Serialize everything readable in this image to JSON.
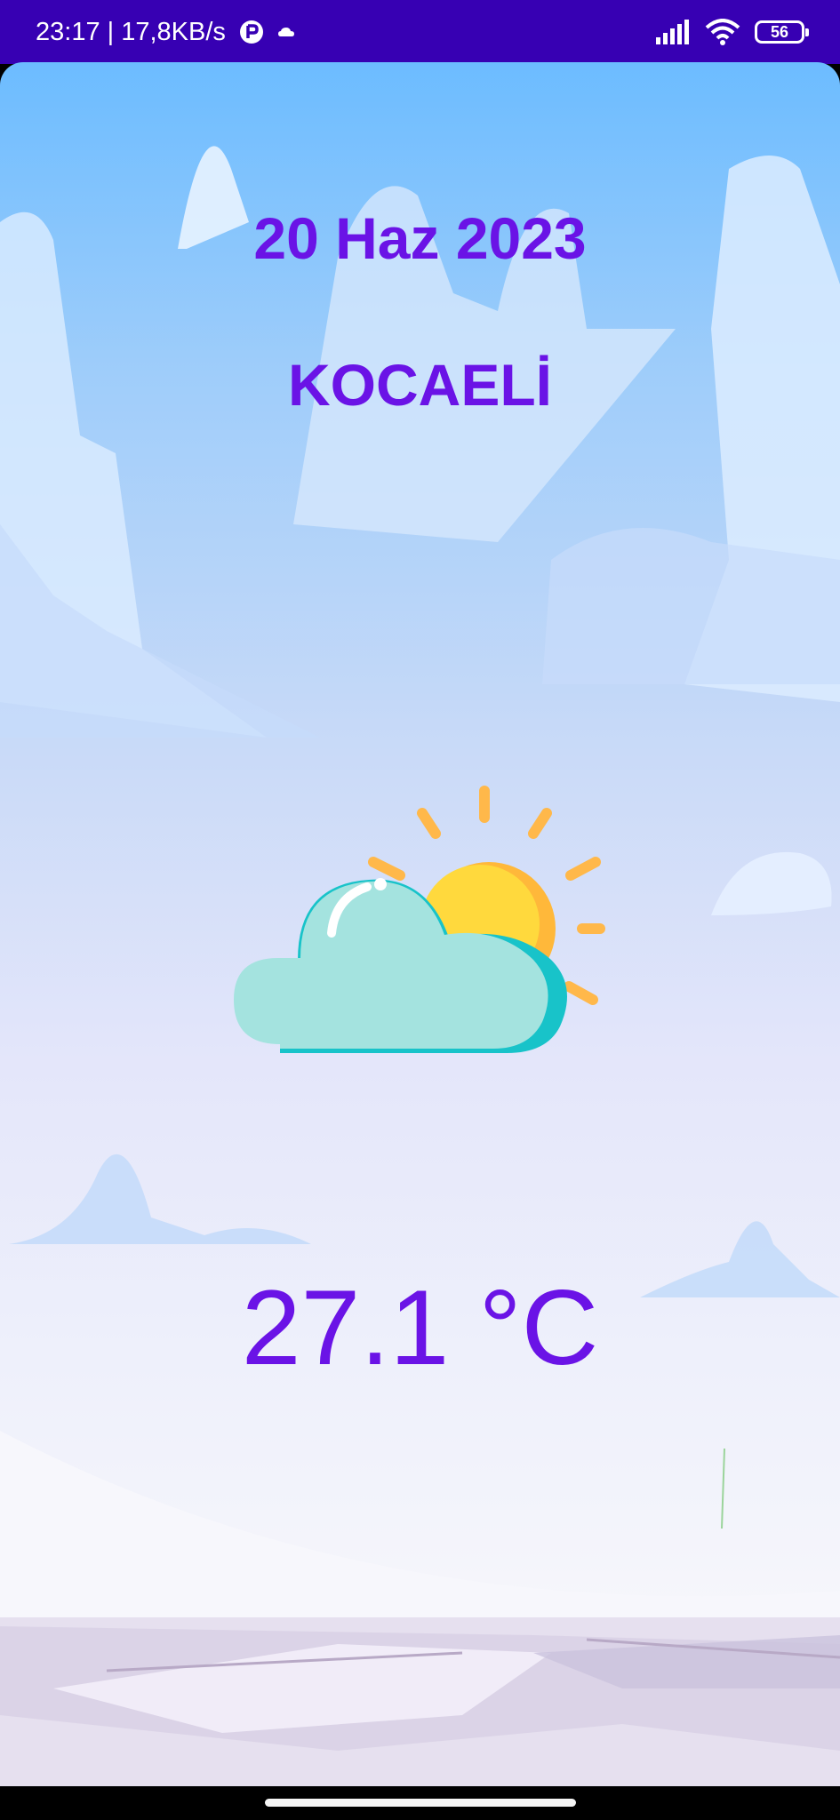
{
  "status_bar": {
    "time_speed": "23:17 | 17,8KB/s",
    "battery_level": "56",
    "icons": [
      "app-notification-icon",
      "cloud-notification-icon",
      "signal-icon",
      "wifi-icon",
      "battery-icon"
    ]
  },
  "weather": {
    "date": "20 Haz 2023",
    "city": "KOCAELİ",
    "condition_icon": "partly-cloudy-icon",
    "temperature": "27.1 °C"
  },
  "colors": {
    "status_bar": "#3700b3",
    "accent_text": "#6a13e6",
    "sun": "#ffd23f",
    "sun_rays": "#ffb84a",
    "cloud": "#a4e3df"
  }
}
